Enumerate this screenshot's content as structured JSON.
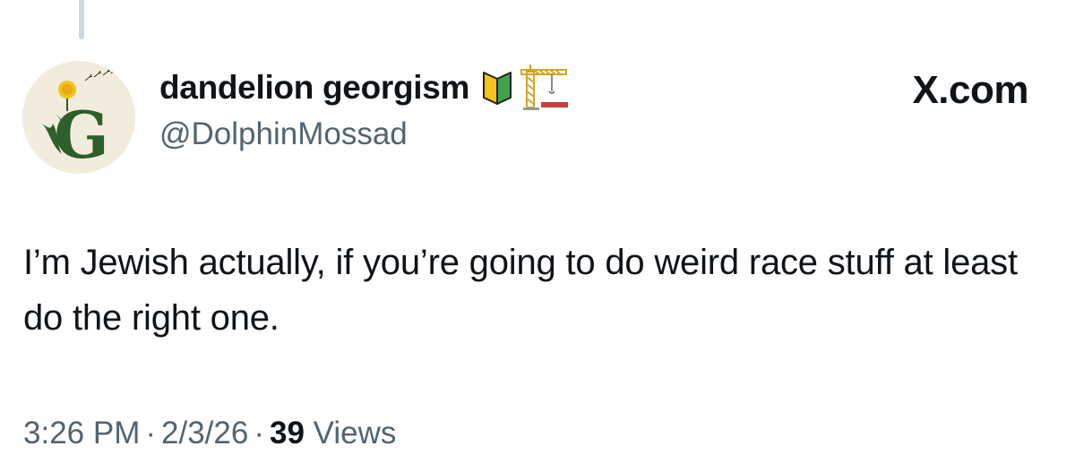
{
  "author": {
    "display_name": "dandelion georgism",
    "handle": "@DolphinMossad",
    "avatar_letter": "G",
    "badges": [
      "beginner-shield-icon",
      "construction-crane-icon"
    ]
  },
  "site": {
    "logo_text": "X.com"
  },
  "tweet": {
    "text": "I’m Jewish actually, if you’re going to do weird race stuff at least do the right one."
  },
  "meta": {
    "time": "3:26 PM",
    "date": "2/3/26",
    "separator": "·",
    "views_count": "39",
    "views_label": "Views"
  },
  "colors": {
    "text": "#0f1419",
    "secondary": "#536471",
    "avatar_bg": "#f1ecdc",
    "avatar_green": "#2e5e2a",
    "dandelion_yellow": "#f2c318"
  }
}
